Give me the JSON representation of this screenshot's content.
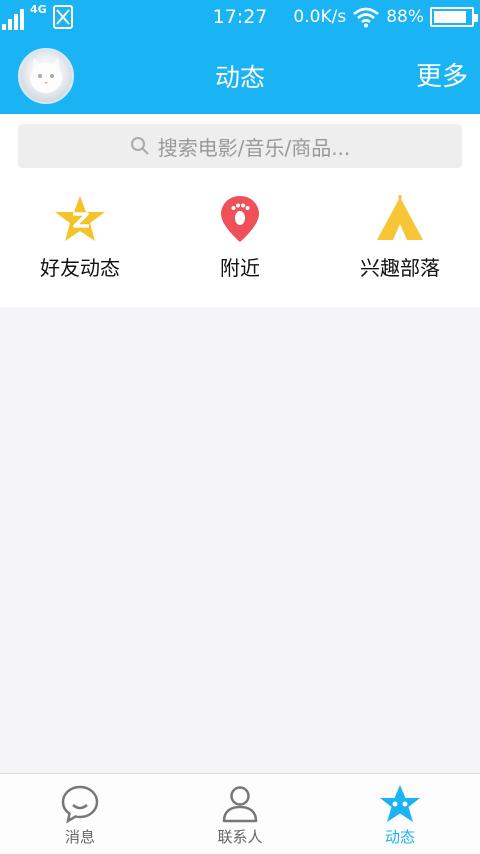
{
  "status_bar": {
    "network": "4G",
    "time": "17:27",
    "speed": "0.0K/s",
    "battery": "88%",
    "battery_level": 0.88
  },
  "header": {
    "avatar_icon": "cat-avatar",
    "title": "动态",
    "more_label": "更多"
  },
  "search": {
    "placeholder": "搜索电影/音乐/商品...",
    "icon": "search-icon"
  },
  "entries": [
    {
      "label": "好友动态",
      "icon": "qzone-star-icon",
      "color": "#f5c327"
    },
    {
      "label": "附近",
      "icon": "location-pin-icon",
      "color": "#f0505a"
    },
    {
      "label": "兴趣部落",
      "icon": "tent-icon",
      "color": "#f6c637"
    }
  ],
  "tabs": [
    {
      "label": "消息",
      "icon": "chat-bubble-icon",
      "active": false
    },
    {
      "label": "联系人",
      "icon": "person-icon",
      "active": false
    },
    {
      "label": "动态",
      "icon": "star-icon",
      "active": true
    }
  ],
  "colors": {
    "accent": "#1ab3f3",
    "background": "#f5f5f7"
  }
}
